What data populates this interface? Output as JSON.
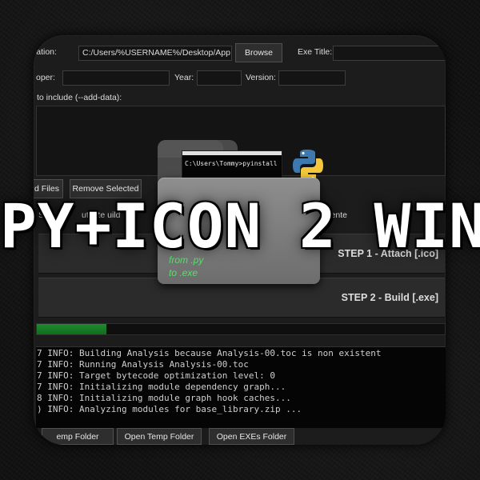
{
  "form": {
    "location_label": "cation:",
    "location_value": "C:/Users/%USERNAME%/Desktop/App D",
    "browse_label": "Browse",
    "exe_title_label": "Exe Title:",
    "developer_label": "oper:",
    "year_label": "Year:",
    "version_label": "Version:",
    "include_label": "to include (--add-data):"
  },
  "file_buttons": {
    "add_files_label": "d Files",
    "remove_selected_label": "Remove Selected"
  },
  "options": {
    "show_label": "Sho",
    "after_build_label": "ut   afte  uild",
    "center_label": "Cente"
  },
  "steps": [
    {
      "label": "STEP 1 - Attach [.ico]"
    },
    {
      "label": "STEP 2 - Build [.exe]"
    }
  ],
  "progress": {
    "value": 0.17,
    "color": "#1f8a2d"
  },
  "console": {
    "lines": [
      "7 INFO: Building Analysis because Analysis-00.toc is non existent",
      "7 INFO: Running Analysis Analysis-00.toc",
      "7 INFO: Target bytecode optimization level: 0",
      "7 INFO: Initializing module dependency graph...",
      "8 INFO: Initializing module graph hook caches...",
      ") INFO: Analyzing modules for base_library.zip ..."
    ]
  },
  "bottom_buttons": {
    "temp_folder_label": "emp Folder",
    "open_temp_folder_label": "Open Temp Folder",
    "open_exes_folder_label": "Open EXEs Folder"
  },
  "logo": {
    "terminal_text": "C:\\Users\\Tommy>pyinstall",
    "from_text": "from .py",
    "to_text": "to .exe",
    "icon": "python-logo-icon",
    "accent_color": "#56e06a"
  },
  "title": "PY+ICON 2 WIN"
}
